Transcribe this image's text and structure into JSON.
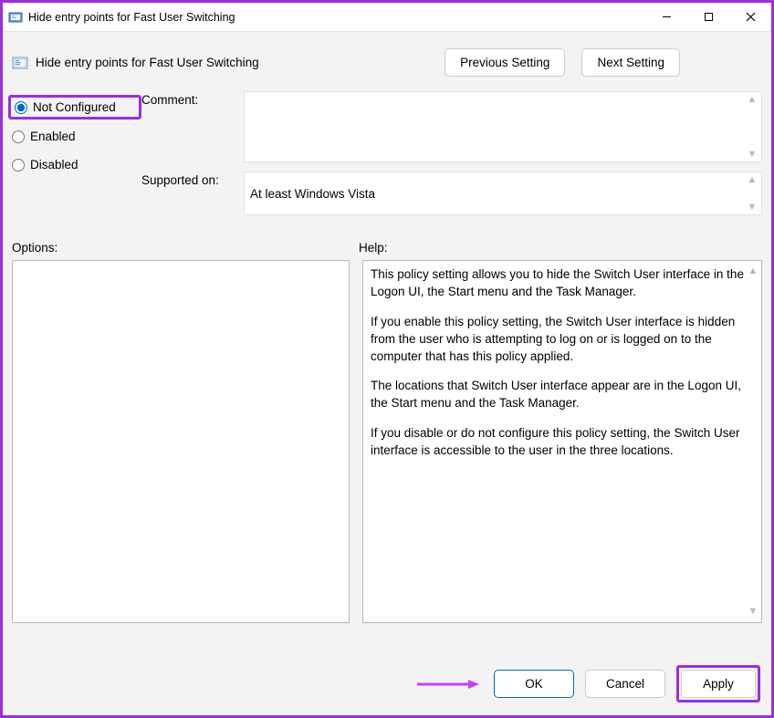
{
  "titlebar": {
    "title": "Hide entry points for Fast User Switching"
  },
  "header": {
    "title": "Hide entry points for Fast User Switching",
    "prev_label": "Previous Setting",
    "next_label": "Next Setting"
  },
  "radios": {
    "not_configured": "Not Configured",
    "enabled": "Enabled",
    "disabled": "Disabled",
    "selected": "not_configured"
  },
  "fields": {
    "comment_label": "Comment:",
    "comment_value": "",
    "supported_label": "Supported on:",
    "supported_value": "At least Windows Vista"
  },
  "labels": {
    "options": "Options:",
    "help": "Help:"
  },
  "help": {
    "p1": "This policy setting allows you to hide the Switch User interface in the Logon UI, the Start menu and the Task Manager.",
    "p2": "If you enable this policy setting, the Switch User interface is hidden from the user who is attempting to log on or is logged on to the computer that has this policy applied.",
    "p3": "The locations that Switch User interface appear are in the Logon UI, the Start menu and the Task Manager.",
    "p4": "If you disable or do not configure this policy setting, the Switch User interface is accessible to the user in the three locations."
  },
  "footer": {
    "ok": "OK",
    "cancel": "Cancel",
    "apply": "Apply"
  }
}
